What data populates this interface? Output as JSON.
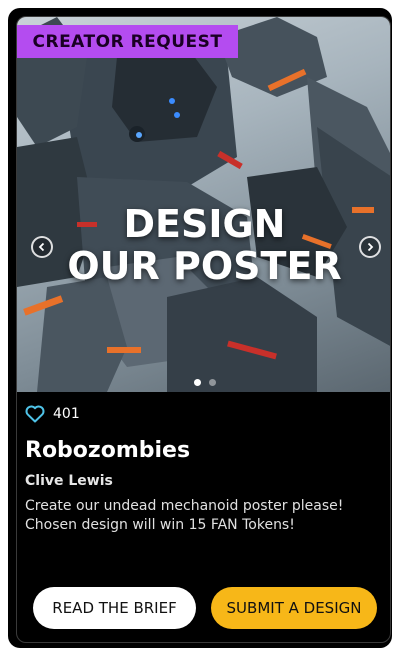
{
  "badge": "CREATOR REQUEST",
  "hero": {
    "title_line1": "DESIGN",
    "title_line2": "OUR POSTER",
    "carousel_total": 2,
    "carousel_active": 1
  },
  "likes": {
    "count": "401",
    "icon": "heart-icon"
  },
  "project": {
    "title": "Robozombies",
    "author": "Clive Lewis",
    "description_line1": "Create our undead mechanoid poster please!",
    "description_line2": "Chosen design will win 15 FAN Tokens!"
  },
  "actions": {
    "read_brief": "READ THE BRIEF",
    "submit_design": "SUBMIT A DESIGN"
  },
  "colors": {
    "badge": "#b44cf0",
    "accent_button": "#f7b718",
    "heart": "#4fc3e8",
    "background": "#000000"
  }
}
